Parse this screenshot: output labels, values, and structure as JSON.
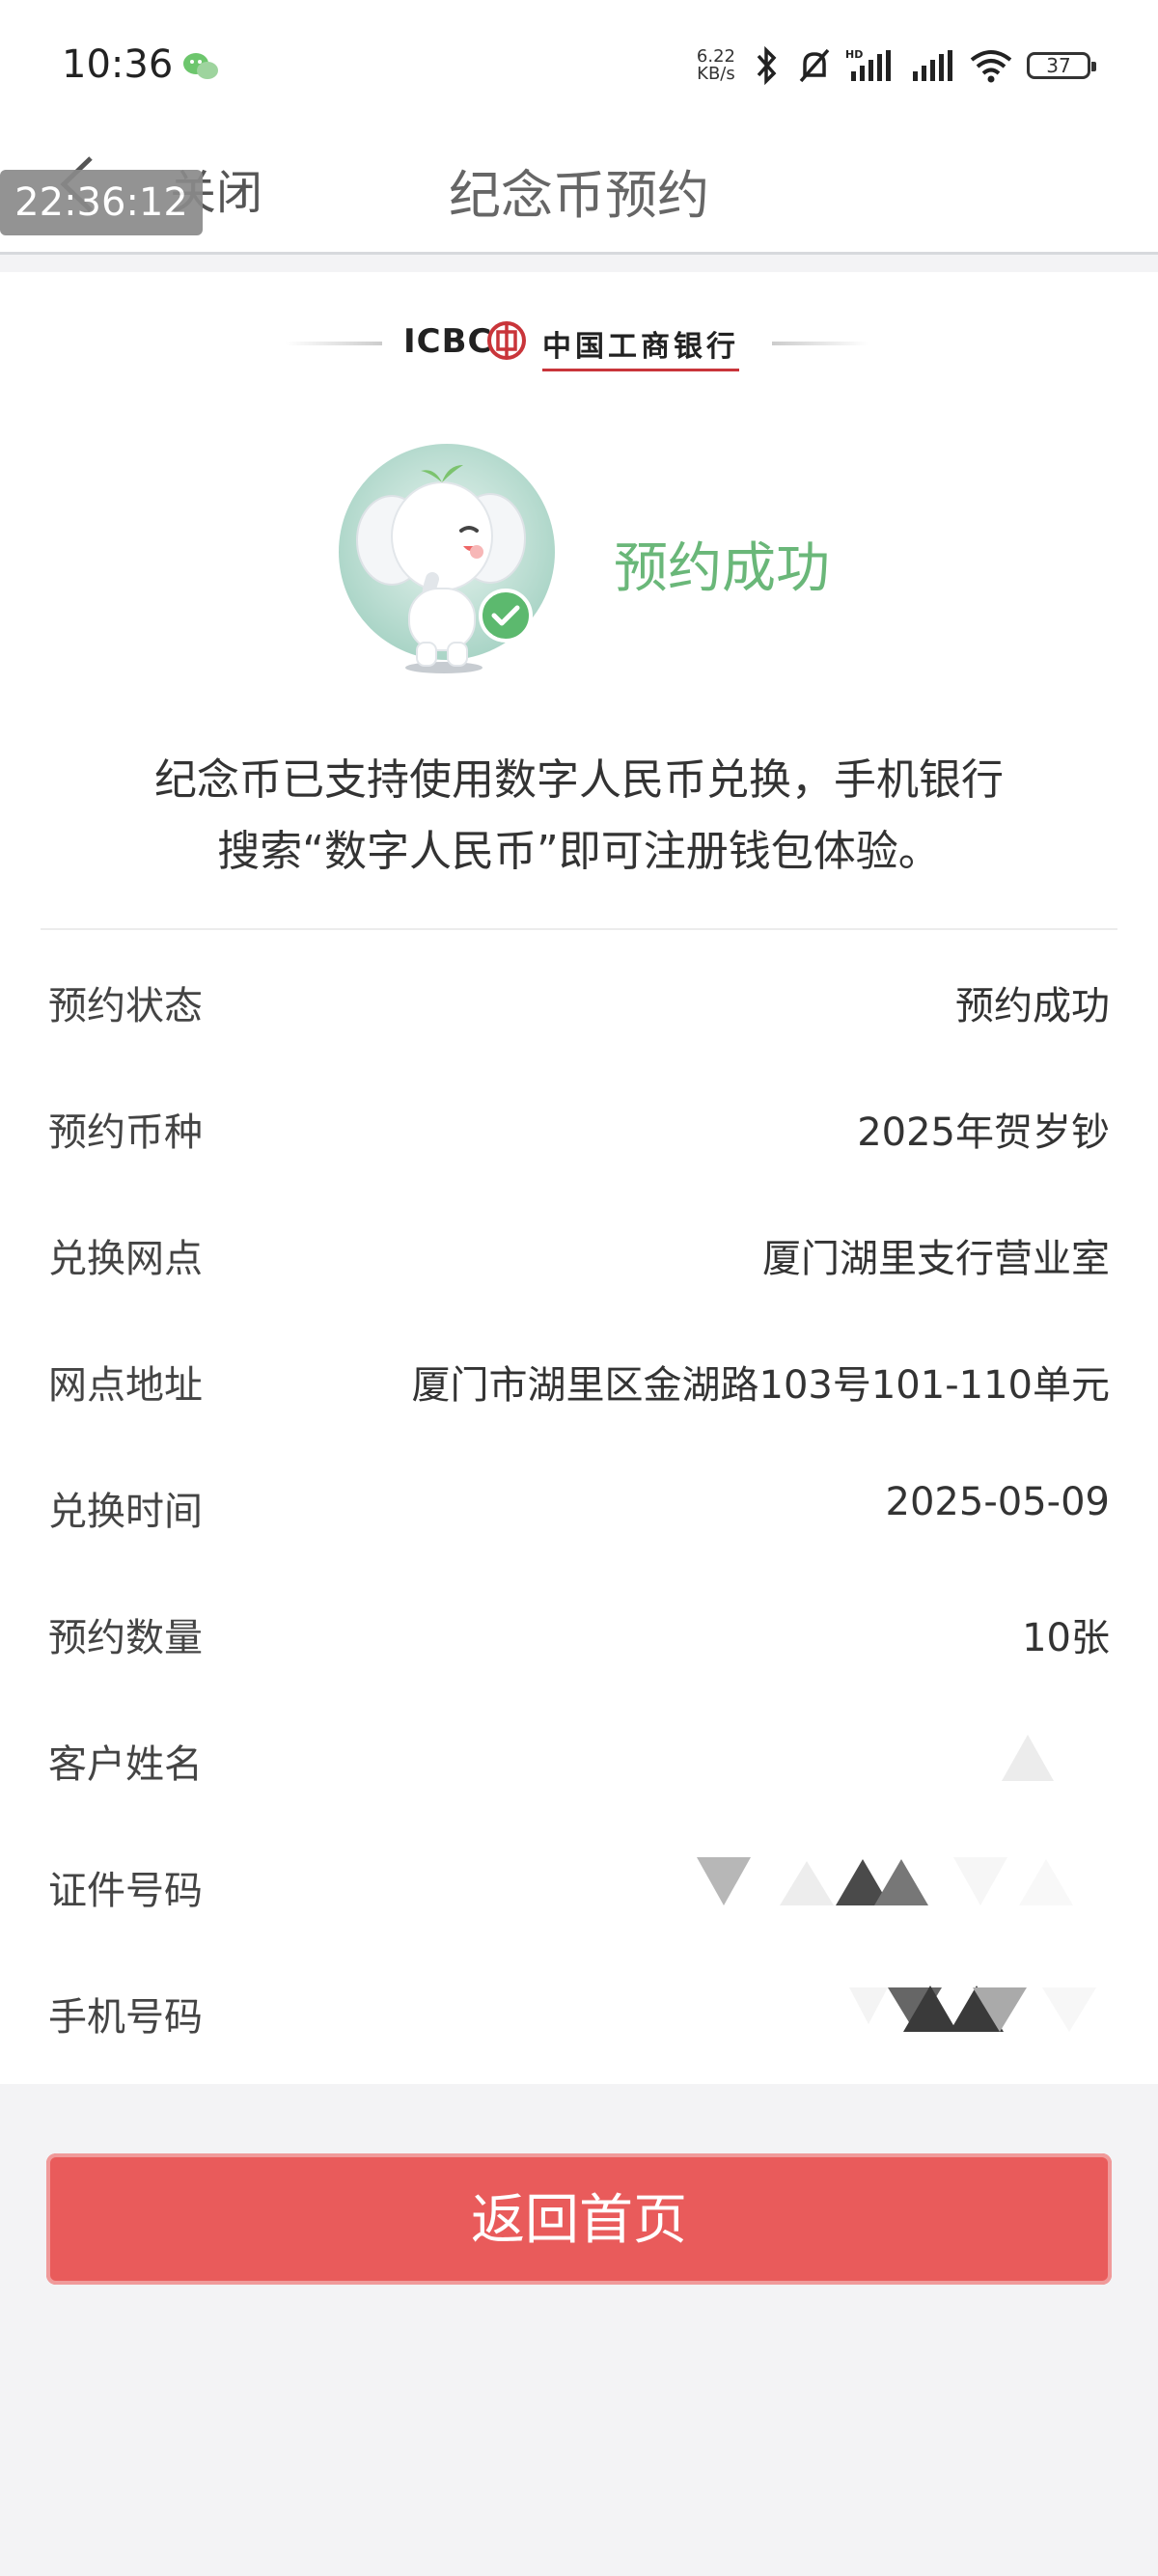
{
  "status_bar": {
    "time": "10:36",
    "net_speed_top": "6.22",
    "net_speed_bottom": "KB/s",
    "battery": "37"
  },
  "nav": {
    "close_label": "关闭",
    "title": "纪念币预约"
  },
  "overlay_timestamp": "22:36:12",
  "bank": {
    "logo_en": "ICBC",
    "logo_cn": "中国工商银行"
  },
  "result": {
    "title": "预约成功",
    "description_line1": "纪念币已支持使用数字人民币兑换，手机银行",
    "description_line2": "搜索“数字人民币”即可注册钱包体验。"
  },
  "details": [
    {
      "label": "预约状态",
      "value": "预约成功"
    },
    {
      "label": "预约币种",
      "value": "2025年贺岁钞"
    },
    {
      "label": "兑换网点",
      "value": "厦门湖里支行营业室"
    },
    {
      "label": "网点地址",
      "value": "厦门市湖里区金湖路103号101-110单元"
    },
    {
      "label": "兑换时间",
      "value": "2025-05-09"
    },
    {
      "label": "预约数量",
      "value": "10张"
    },
    {
      "label": "客户姓名",
      "value": ""
    },
    {
      "label": "证件号码",
      "value": ""
    },
    {
      "label": "手机号码",
      "value": ""
    }
  ],
  "actions": {
    "home_button": "返回首页"
  },
  "colors": {
    "success_green": "#6ab779",
    "button_red": "#e95b5b",
    "icbc_red": "#c9353a"
  }
}
